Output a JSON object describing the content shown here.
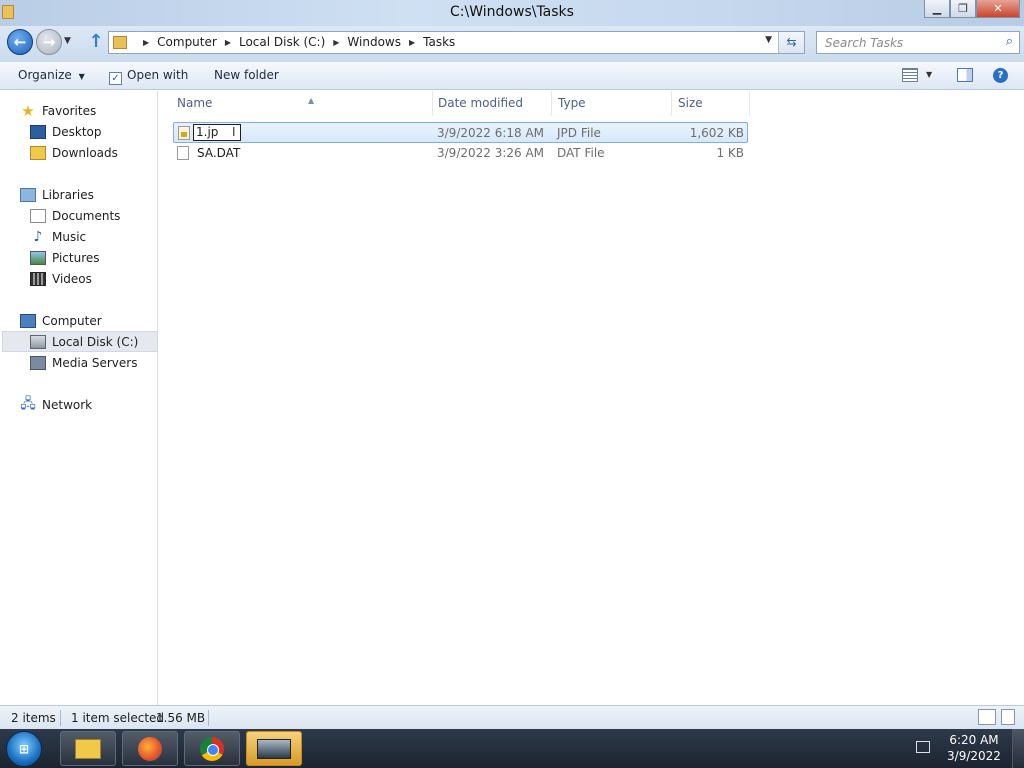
{
  "window": {
    "title": "C:\\Windows\\Tasks",
    "minimize_icon": "minimize-icon",
    "maximize_icon": "restore-icon",
    "close_icon": "close-icon"
  },
  "address": {
    "breadcrumbs": [
      "Computer",
      "Local Disk (C:)",
      "Windows",
      "Tasks"
    ],
    "search_placeholder": "Search Tasks"
  },
  "toolbar": {
    "organize": "Organize",
    "open_with": "Open with",
    "new_folder": "New folder"
  },
  "nav": {
    "favorites": {
      "label": "Favorites",
      "items": [
        "Desktop",
        "Downloads"
      ]
    },
    "libraries": {
      "label": "Libraries",
      "items": [
        "Documents",
        "Music",
        "Pictures",
        "Videos"
      ]
    },
    "computer": {
      "label": "Computer",
      "items": [
        "Local Disk (C:)",
        "Media Servers"
      ]
    },
    "network": {
      "label": "Network"
    },
    "selected": "Local Disk (C:)"
  },
  "columns": [
    "Name",
    "Date modified",
    "Type",
    "Size"
  ],
  "files": [
    {
      "name": "1.jpd",
      "rename_text": "1.jp",
      "date": "3/9/2022 6:18 AM",
      "type": "JPD File",
      "size": "1,602 KB",
      "selected": true,
      "renaming": true
    },
    {
      "name": "SA.DAT",
      "date": "3/9/2022 3:26 AM",
      "type": "DAT File",
      "size": "1 KB",
      "selected": false
    }
  ],
  "status": {
    "item_count": "2 items",
    "selection": "1 item selected",
    "selection_size": "1.56 MB"
  },
  "taskbar": {
    "pinned": [
      "windows-explorer",
      "firefox",
      "chrome",
      "app"
    ],
    "time": "6:20 AM",
    "date": "3/9/2022"
  }
}
